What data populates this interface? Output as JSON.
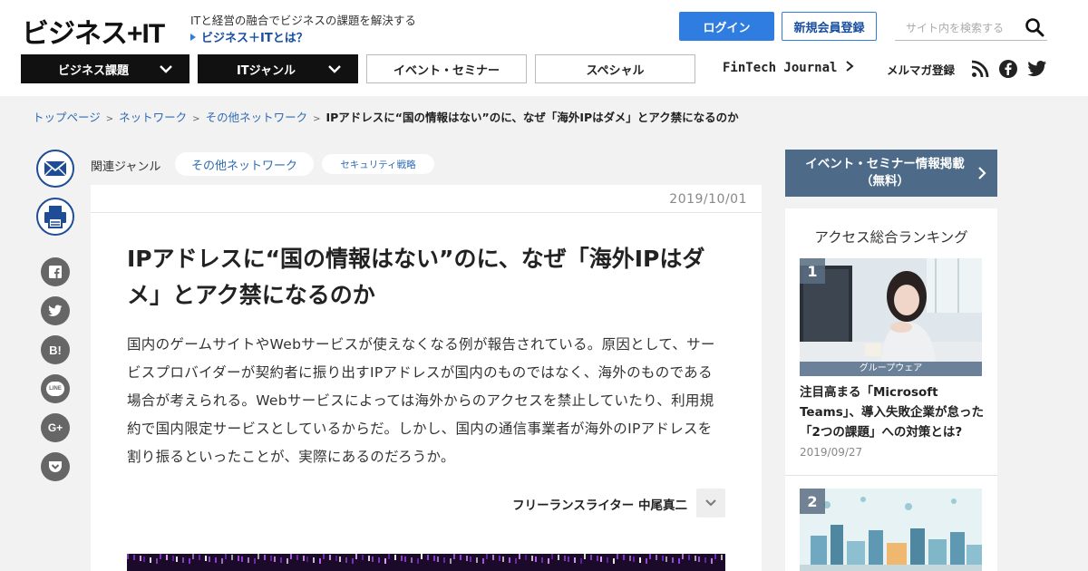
{
  "header": {
    "logo": "ビジネス+IT",
    "tagline": "ITと経営の融合でビジネスの課題を解決する",
    "about_link": "ビジネス＋ITとは？",
    "login_label": "ログイン",
    "register_label": "新規会員登録",
    "search_placeholder": "サイト内を検索する"
  },
  "nav": {
    "business_label": "ビジネス課題",
    "itgenre_label": "ITジャンル",
    "event_label": "イベント・セミナー",
    "special_label": "スペシャル",
    "fintech_label": "FinTech Journal",
    "mailmag_label": "メルマガ登録"
  },
  "breadcrumb": {
    "items": [
      "トップページ",
      "ネットワーク",
      "その他ネットワーク"
    ],
    "current": "IPアドレスに“国の情報はない”のに、なぜ「海外IPはダメ」とアク禁になるのか"
  },
  "genres": {
    "label": "関連ジャンル",
    "tags": [
      "その他ネットワーク",
      "セキュリティ戦略"
    ]
  },
  "share": {
    "hatena": "B!",
    "line": "LINE",
    "gplus": "G+"
  },
  "article": {
    "date": "2019/10/01",
    "title": "IPアドレスに“国の情報はない”のに、なぜ「海外IPはダメ」とアク禁になるのか",
    "lead": "国内のゲームサイトやWebサービスが使えなくなる例が報告されている。原因として、サービスプロバイダーが契約者に振り出すIPアドレスが国内のものではなく、海外のものである場合が考えられる。Webサービスによっては海外からのアクセスを禁止していたり、利用規約で国内限定サービスとしているからだ。しかし、国内の通信事業者が海外のIPアドレスを割り振るといったことが、実際にあるのだろうか。",
    "author": "フリーランスライター 中尾真二"
  },
  "sidebar": {
    "event_banner_line1": "イベント・セミナー情報掲載",
    "event_banner_line2": "（無料）",
    "ranking_title": "アクセス総合ランキング",
    "items": [
      {
        "rank": "1",
        "category": "グループウェア",
        "headline": "注目高まる「Microsoft Teams」、導入失敗企業が怠った「2つの課題」への対策とは?",
        "date": "2019/09/27"
      },
      {
        "rank": "2"
      }
    ]
  },
  "colors": {
    "accent": "#2f7de1",
    "nav_dark": "#111111",
    "sidebar_banner": "#4d6a88",
    "link": "#2f6bb5"
  }
}
